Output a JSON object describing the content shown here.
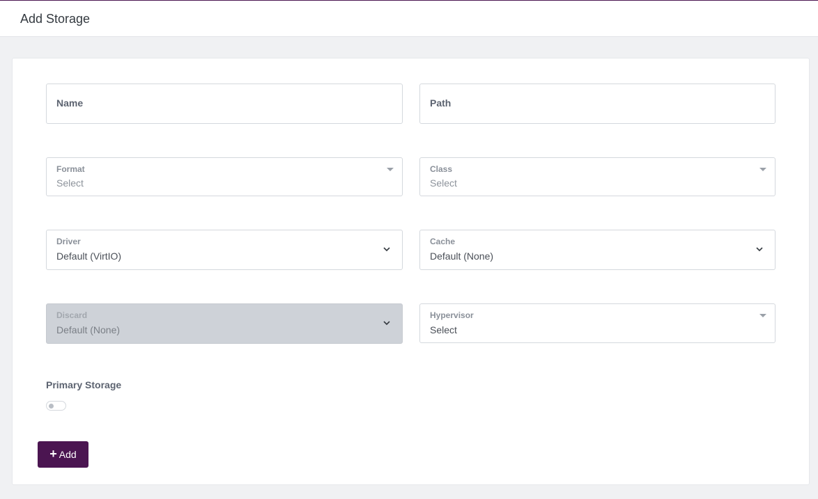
{
  "header": {
    "title": "Add Storage"
  },
  "form": {
    "name": {
      "label": "Name",
      "value": ""
    },
    "path": {
      "label": "Path",
      "value": ""
    },
    "format": {
      "label": "Format",
      "value": "Select"
    },
    "class": {
      "label": "Class",
      "value": "Select"
    },
    "driver": {
      "label": "Driver",
      "value": "Default (VirtIO)"
    },
    "cache": {
      "label": "Cache",
      "value": "Default (None)"
    },
    "discard": {
      "label": "Discard",
      "value": "Default (None)",
      "disabled": true
    },
    "hypervisor": {
      "label": "Hypervisor",
      "value": "Select"
    },
    "primary_storage": {
      "label": "Primary Storage",
      "enabled": false
    }
  },
  "actions": {
    "add_label": "Add",
    "add_icon": "plus-icon"
  },
  "colors": {
    "accent": "#4b1551",
    "disabled_field": "#ced2d8"
  }
}
